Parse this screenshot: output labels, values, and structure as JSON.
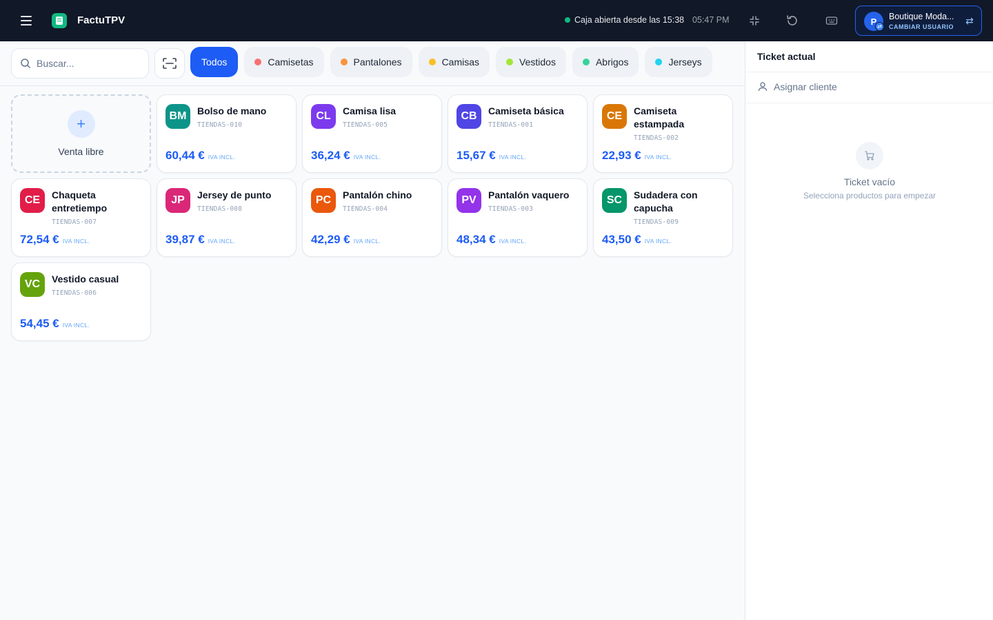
{
  "app": {
    "title": "FactuTPV"
  },
  "topbar": {
    "status": "Caja abierta desde las 15:38",
    "time": "05:47 PM",
    "user": {
      "initial": "P",
      "name": "Boutique Moda...",
      "sub": "CAMBIAR USUARIO"
    }
  },
  "search": {
    "placeholder": "Buscar..."
  },
  "categories": [
    {
      "label": "Todos",
      "color": ""
    },
    {
      "label": "Camisetas",
      "color": "#f87171"
    },
    {
      "label": "Pantalones",
      "color": "#fb923c"
    },
    {
      "label": "Camisas",
      "color": "#fbbf24"
    },
    {
      "label": "Vestidos",
      "color": "#a3e635"
    },
    {
      "label": "Abrigos",
      "color": "#34d399"
    },
    {
      "label": "Jerseys",
      "color": "#22d3ee"
    }
  ],
  "free_sale": {
    "label": "Venta libre"
  },
  "products": [
    {
      "initials": "BM",
      "name": "Bolso de mano",
      "sku": "TIENDAS-010",
      "price": "60,44 €",
      "tax": "IVA INCL.",
      "color": "#0d9488"
    },
    {
      "initials": "CL",
      "name": "Camisa lisa",
      "sku": "TIENDAS-005",
      "price": "36,24 €",
      "tax": "IVA INCL.",
      "color": "#7c3aed"
    },
    {
      "initials": "CB",
      "name": "Camiseta básica",
      "sku": "TIENDAS-001",
      "price": "15,67 €",
      "tax": "IVA INCL.",
      "color": "#4f46e5"
    },
    {
      "initials": "CE",
      "name": "Camiseta estampada",
      "sku": "TIENDAS-002",
      "price": "22,93 €",
      "tax": "IVA INCL.",
      "color": "#d97706"
    },
    {
      "initials": "CE",
      "name": "Chaqueta entretiempo",
      "sku": "TIENDAS-007",
      "price": "72,54 €",
      "tax": "IVA INCL.",
      "color": "#e11d48"
    },
    {
      "initials": "JP",
      "name": "Jersey de punto",
      "sku": "TIENDAS-008",
      "price": "39,87 €",
      "tax": "IVA INCL.",
      "color": "#db2777"
    },
    {
      "initials": "PC",
      "name": "Pantalón chino",
      "sku": "TIENDAS-004",
      "price": "42,29 €",
      "tax": "IVA INCL.",
      "color": "#ea580c"
    },
    {
      "initials": "PV",
      "name": "Pantalón vaquero",
      "sku": "TIENDAS-003",
      "price": "48,34 €",
      "tax": "IVA INCL.",
      "color": "#9333ea"
    },
    {
      "initials": "SC",
      "name": "Sudadera con capucha",
      "sku": "TIENDAS-009",
      "price": "43,50 €",
      "tax": "IVA INCL.",
      "color": "#059669"
    },
    {
      "initials": "VC",
      "name": "Vestido casual",
      "sku": "TIENDAS-006",
      "price": "54,45 €",
      "tax": "IVA INCL.",
      "color": "#65a30d"
    }
  ],
  "ticket": {
    "title": "Ticket actual",
    "assign": "Asignar cliente",
    "empty_title": "Ticket vacío",
    "empty_sub": "Selecciona productos para empezar"
  },
  "icons": [
    "menu-icon",
    "app-logo-icon",
    "fullscreen-icon",
    "refresh-icon",
    "keyboard-icon",
    "switch-user-icon",
    "search-icon",
    "scan-icon",
    "plus-icon",
    "user-icon",
    "cart-icon"
  ]
}
